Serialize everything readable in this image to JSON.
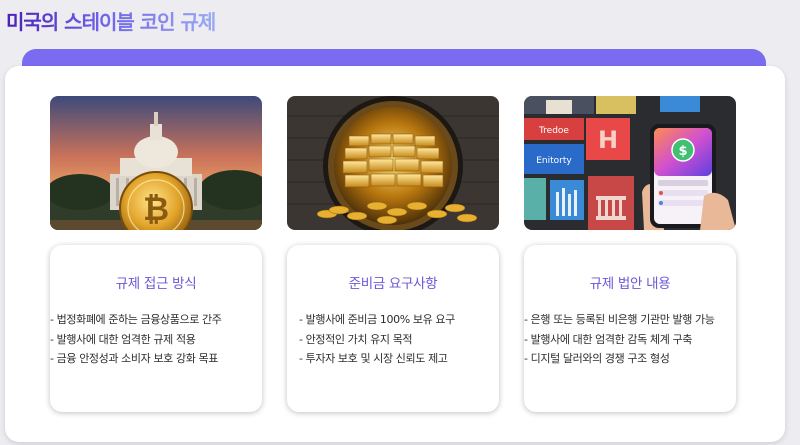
{
  "header": {
    "title": "미국의 스테이블 코인 규제"
  },
  "columns": [
    {
      "image_icon": "capitol-bitcoin-illustration",
      "title": "규제 접근 방식",
      "items": [
        "- 법정화폐에 준하는 금융상품으로 간주",
        "- 발행사에 대한 엄격한 규제 적용",
        "- 금융 안정성과 소비자 보호 강화 목표"
      ]
    },
    {
      "image_icon": "gold-vault-illustration",
      "title": "준비금 요구사항",
      "items": [
        "- 발행사에 준비금 100% 보유 요구",
        "- 안정적인 가치 유지 목적",
        "- 투자자 보호 및 시장 신뢰도 제고"
      ]
    },
    {
      "image_icon": "bank-app-phone-illustration",
      "photo_labels": [
        "Tredoe",
        "Enitorty"
      ],
      "title": "규제 법안 내용",
      "items": [
        "- 은행 또는 등록된 비은행 기관만 발행 가능",
        "- 발행사에 대한 엄격한 감독 체계 구축",
        "- 디지털 달러와의 경쟁 구조 형성"
      ]
    }
  ],
  "colors": {
    "accent": "#7a6cf0",
    "card_title": "#6a58d8",
    "title_gradient": [
      "#4a1fb8",
      "#6f61e8",
      "#9aa9f2"
    ]
  }
}
